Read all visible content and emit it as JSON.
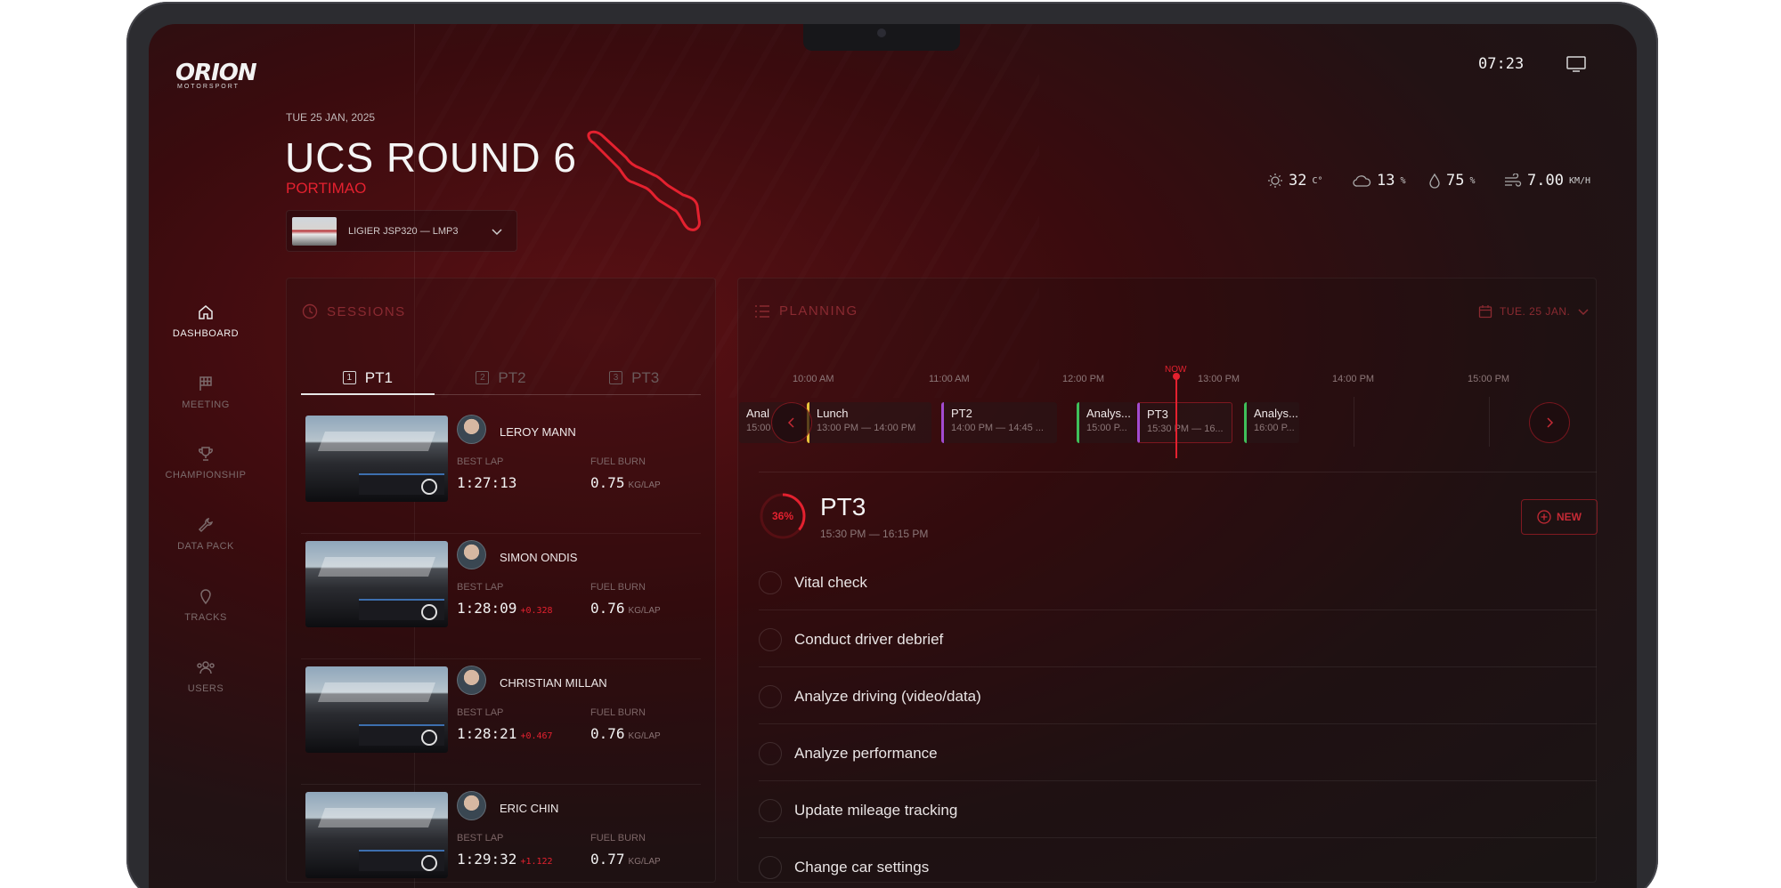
{
  "brand": {
    "wordmark": "ORION",
    "subline": "MOTORSPORT"
  },
  "status": {
    "clock": "07:23"
  },
  "nav": [
    {
      "label": "DASHBOARD",
      "icon": "home-icon",
      "active": true
    },
    {
      "label": "MEETING",
      "icon": "flag-icon"
    },
    {
      "label": "CHAMPIONSHIP",
      "icon": "trophy-icon"
    },
    {
      "label": "DATA PACK",
      "icon": "wrench-icon"
    },
    {
      "label": "TRACKS",
      "icon": "location-pin-icon"
    },
    {
      "label": "USERS",
      "icon": "users-icon"
    }
  ],
  "event": {
    "date": "TUE 25 JAN, 2025",
    "title": "UCS ROUND 6",
    "circuit": "PORTIMAO",
    "car": "LIGIER JSP320 — LMP3"
  },
  "weather": {
    "temp": "32",
    "temp_unit": "C°",
    "cloud": "13",
    "cloud_unit": "%",
    "humidity": "75",
    "humidity_unit": "%",
    "wind": "7.00",
    "wind_unit": "KM/H"
  },
  "sessions": {
    "title": "SESSIONS",
    "tabs": [
      {
        "num": "1",
        "label": "PT1",
        "active": true
      },
      {
        "num": "2",
        "label": "PT2"
      },
      {
        "num": "3",
        "label": "PT3"
      }
    ],
    "best_lap_label": "BEST LAP",
    "fuel_burn_label": "FUEL BURN",
    "fuel_unit": "KG/LAP",
    "drivers": [
      {
        "name": "LEROY MANN",
        "best_lap": "1:27:13",
        "delta": "",
        "fuel": "0.75"
      },
      {
        "name": "SIMON ONDIS",
        "best_lap": "1:28:09",
        "delta": "+0.328",
        "fuel": "0.76"
      },
      {
        "name": "CHRISTIAN MILLAN",
        "best_lap": "1:28:21",
        "delta": "+0.467",
        "fuel": "0.76"
      },
      {
        "name": "ERIC CHIN",
        "best_lap": "1:29:32",
        "delta": "+1.122",
        "fuel": "0.77"
      }
    ]
  },
  "planning": {
    "title": "PLANNING",
    "date": "TUE. 25 JAN.",
    "now_label": "NOW",
    "times": [
      "10:00 AM",
      "11:00 AM",
      "12:00 PM",
      "13:00 PM",
      "14:00 PM",
      "15:00 PM"
    ],
    "events": [
      {
        "name": "Anal",
        "time": "15:00",
        "color": "#9a9a9a"
      },
      {
        "name": "Lunch",
        "time": "13:00 PM — 14:00 PM",
        "color": "#e8c23a"
      },
      {
        "name": "PT2",
        "time": "14:00 PM — 14:45 ...",
        "color": "#a24bd0"
      },
      {
        "name": "Analys...",
        "time": "15:00 P...",
        "color": "#3fbf5a"
      },
      {
        "name": "PT3",
        "time": "15:30 PM — 16...",
        "color": "#a24bd0"
      },
      {
        "name": "Analys...",
        "time": "16:00 P...",
        "color": "#3fbf5a"
      }
    ],
    "current": {
      "progress_text": "36%",
      "progress": 0.36,
      "title": "PT3",
      "time": "15:30 PM — 16:15 PM",
      "new_label": "NEW"
    },
    "tasks": [
      "Vital check",
      "Conduct driver debrief",
      "Analyze driving (video/data)",
      "Analyze performance",
      "Update mileage tracking",
      "Change car settings"
    ]
  },
  "colors": {
    "accent": "#e4212f",
    "bg": "#221214"
  }
}
